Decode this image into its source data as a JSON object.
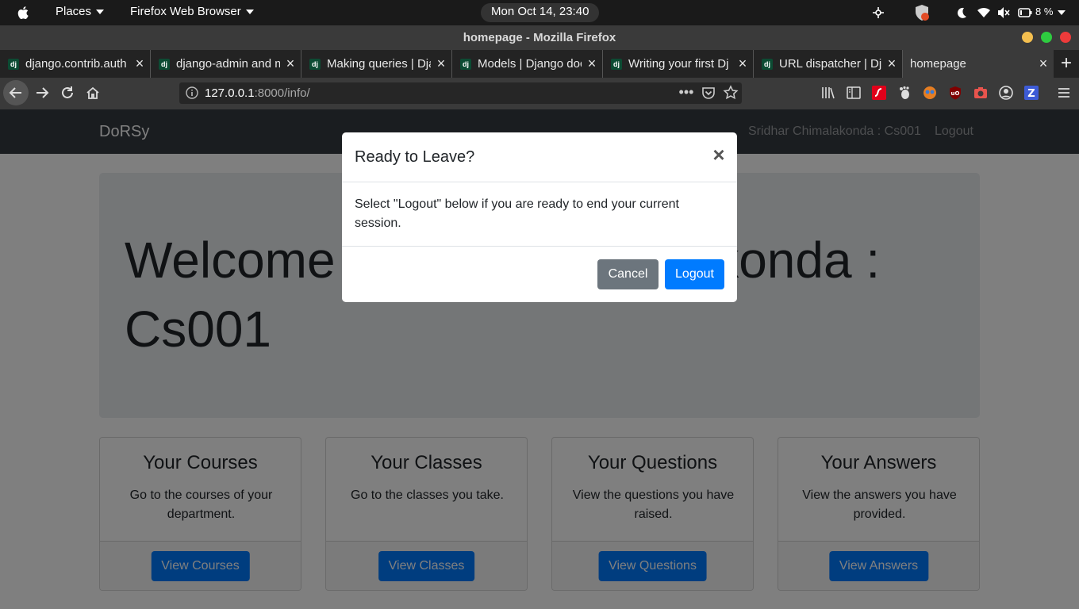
{
  "topbar": {
    "places_label": "Places",
    "app_menu_label": "Firefox Web Browser",
    "clock": "Mon Oct 14, 23:40",
    "battery_percent": "8 %"
  },
  "window": {
    "title": "homepage - Mozilla Firefox"
  },
  "tabs": [
    {
      "label": "django.contrib.auth",
      "favicon": "dj"
    },
    {
      "label": "django-admin and m",
      "favicon": "dj"
    },
    {
      "label": "Making queries | Dja",
      "favicon": "dj"
    },
    {
      "label": "Models | Django doc",
      "favicon": "dj"
    },
    {
      "label": "Writing your first Dj",
      "favicon": "dj"
    },
    {
      "label": "URL dispatcher | Dja",
      "favicon": "dj"
    },
    {
      "label": "homepage",
      "favicon": ""
    }
  ],
  "url": {
    "host": "127.0.0.1",
    "rest": ":8000/info/"
  },
  "site": {
    "brand": "DoRSy",
    "user": "Sridhar Chimalakonda : Cs001",
    "logout_link": "Logout",
    "welcome": "Welcome Sridhar Chimalakonda : Cs001"
  },
  "cards": [
    {
      "title": "Your Courses",
      "text": "Go to the courses of your department.",
      "button": "View Courses"
    },
    {
      "title": "Your Classes",
      "text": "Go to the classes you take.",
      "button": "View Classes"
    },
    {
      "title": "Your Questions",
      "text": "View the questions you have raised.",
      "button": "View Questions"
    },
    {
      "title": "Your Answers",
      "text": "View the answers you have provided.",
      "button": "View Answers"
    }
  ],
  "modal": {
    "title": "Ready to Leave?",
    "close": "×",
    "body": "Select \"Logout\" below if you are ready to end your current session.",
    "cancel": "Cancel",
    "logout": "Logout"
  },
  "colors": {
    "primary": "#007bff",
    "secondary": "#6c757d",
    "navbar": "#343a40",
    "jumbotron": "#e9ecef"
  }
}
